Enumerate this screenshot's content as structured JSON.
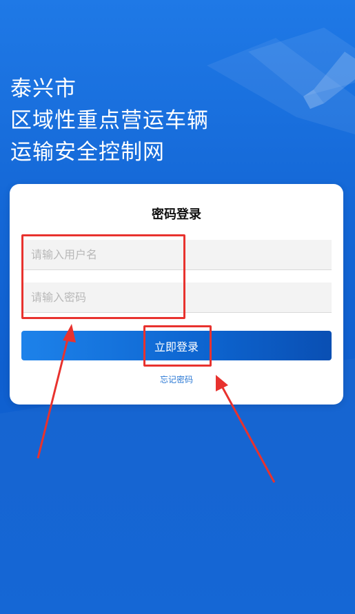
{
  "title": {
    "line1": "泰兴市",
    "line2": "区域性重点营运车辆",
    "line3": "运输安全控制网"
  },
  "login_card": {
    "heading": "密码登录",
    "username_placeholder": "请输入用户名",
    "password_placeholder": "请输入密码",
    "username_value": "",
    "password_value": "",
    "login_button": "立即登录",
    "forgot_link": "忘记密码"
  },
  "colors": {
    "background": "#1467d6",
    "button": "#0d64cf",
    "link": "#2a78d4",
    "annotation": "#e8322e"
  }
}
